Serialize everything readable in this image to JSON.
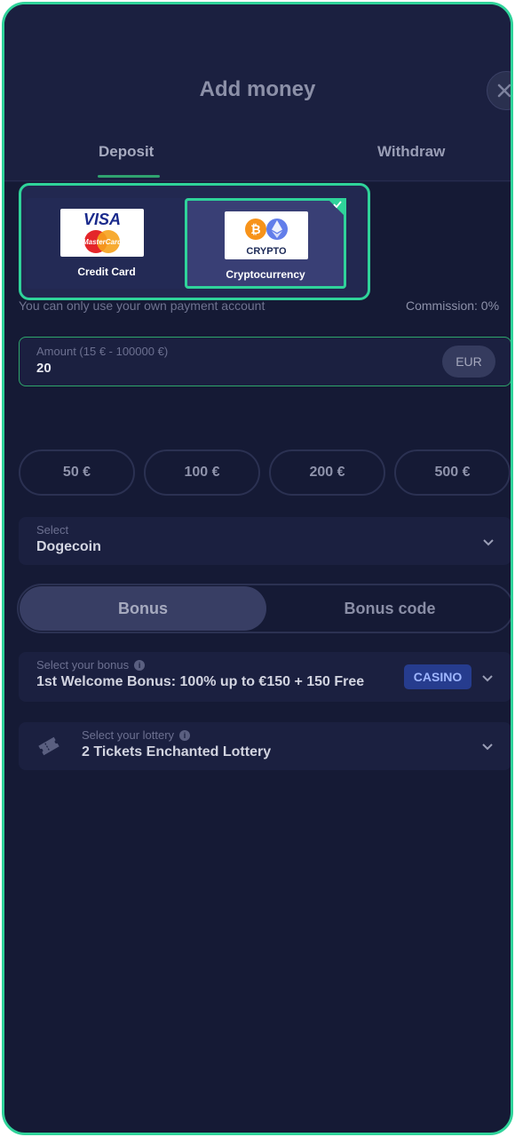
{
  "modal": {
    "title": "Add money"
  },
  "tabs": [
    {
      "label": "Deposit",
      "active": true
    },
    {
      "label": "Withdraw",
      "active": false
    }
  ],
  "payment_methods": [
    {
      "label": "Credit Card",
      "logo_text": [
        "VISA",
        "MasterCard"
      ],
      "selected": false
    },
    {
      "label": "Cryptocurrency",
      "logo_text": "CRYPTO",
      "selected": true
    }
  ],
  "info": {
    "own_account_note": "You can only use your own payment account",
    "commission": "Commission: 0%"
  },
  "amount": {
    "label": "Amount (15 € - 100000 €)",
    "value": "20",
    "currency": "EUR"
  },
  "presets": [
    "50 €",
    "100 €",
    "200 €",
    "500 €"
  ],
  "coin_select": {
    "label": "Select",
    "value": "Dogecoin"
  },
  "bonus_toggle": {
    "active": "Bonus",
    "inactive": "Bonus code"
  },
  "bonus_select": {
    "label": "Select your bonus",
    "value": "1st Welcome Bonus: 100% up to €150 + 150 Free",
    "badge": "CASINO"
  },
  "lottery_select": {
    "label": "Select your lottery",
    "value": "2 Tickets Enchanted Lottery"
  },
  "colors": {
    "background": "#151a35",
    "accent_green": "#2fd39a",
    "badge_blue": "#263c8e"
  }
}
